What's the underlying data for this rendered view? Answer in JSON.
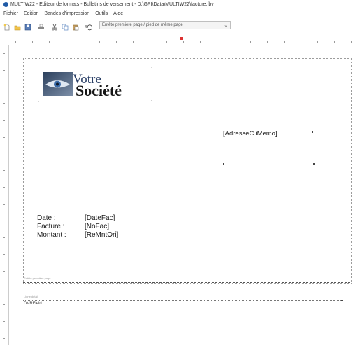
{
  "window": {
    "title": "MULTIW22 - Editeur de formats - Bulletins de versement - D:\\GPI\\Data\\MULTIW22\\facture.fbv"
  },
  "menu": [
    "Fichier",
    "Edition",
    "Bandes d'impression",
    "Outils",
    "Aide"
  ],
  "toolbar": {
    "icons": [
      "new-icon",
      "open-icon",
      "save-icon",
      "print-icon",
      "cut-icon",
      "copy-icon",
      "paste-icon",
      "undo-icon"
    ],
    "combo_value": "Entête première page / pied de même page"
  },
  "report": {
    "logo_line1": "Votre",
    "logo_line2": "Société",
    "address_field": "[AdresseCliMemo]",
    "labels": [
      "Date :",
      "Facture :",
      "Montant :"
    ],
    "fields": [
      "[DateFac]",
      "[NoFac]",
      "[ReMntOri]"
    ],
    "band1_label": "Entête première page",
    "band2_label": "Ligne détail",
    "dvr_field": "DVRField"
  },
  "colors": {
    "accent": "#1f5aa6",
    "ruler_marker": "#d33333"
  }
}
